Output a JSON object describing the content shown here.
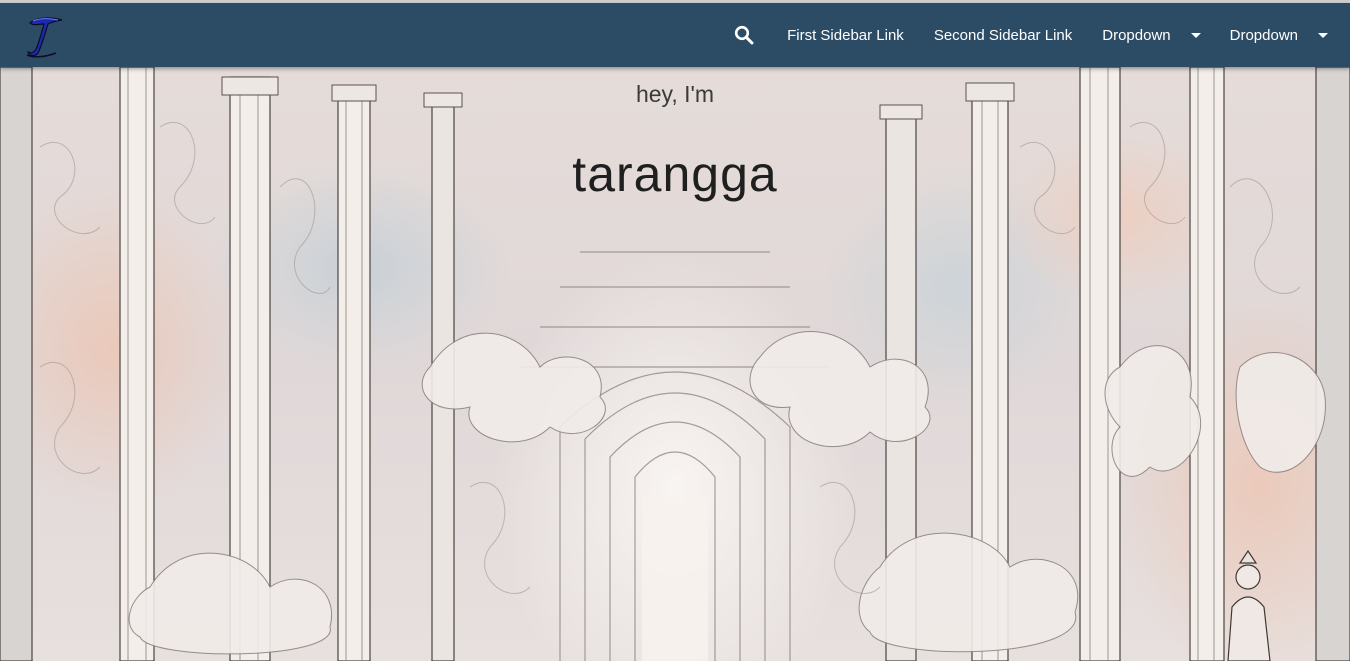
{
  "window": {
    "top_strip_color": "#cfcfcf"
  },
  "navbar": {
    "background": "#2c4b64",
    "logo_icon": "calligraphic-t-logo",
    "search_icon": "search-icon",
    "links": {
      "first": "First Sidebar Link",
      "second": "Second Sidebar Link"
    },
    "dropdowns": {
      "first": "Dropdown",
      "second": "Dropdown"
    }
  },
  "hero": {
    "subtitle": "hey, I'm",
    "title": "tarangga",
    "background_icon": "fantasy-temple-illustration"
  }
}
